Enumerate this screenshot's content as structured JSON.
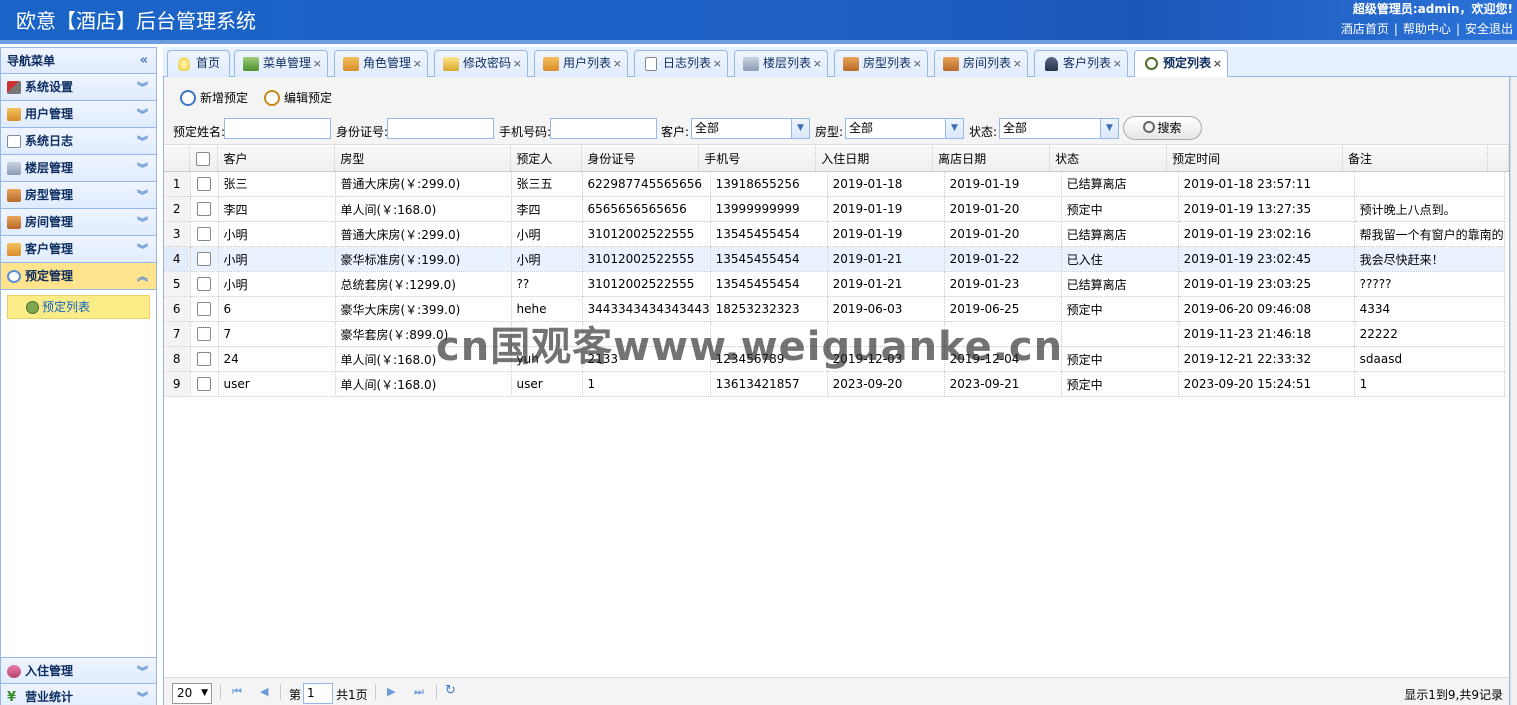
{
  "header": {
    "title": "欧意【酒店】后台管理系统",
    "welcome": "超级管理员:admin，欢迎您!",
    "links": [
      "酒店首页",
      "帮助中心",
      "安全退出"
    ]
  },
  "sidebar": {
    "title": "导航菜单",
    "items": [
      {
        "label": "系统设置",
        "icon": "tools-icon"
      },
      {
        "label": "用户管理",
        "icon": "users-icon"
      },
      {
        "label": "系统日志",
        "icon": "log-icon"
      },
      {
        "label": "楼层管理",
        "icon": "building-icon"
      },
      {
        "label": "房型管理",
        "icon": "house-icon"
      },
      {
        "label": "房间管理",
        "icon": "house-icon"
      },
      {
        "label": "客户管理",
        "icon": "users-icon"
      },
      {
        "label": "预定管理",
        "icon": "clock-icon"
      }
    ],
    "active_sub": "预定列表",
    "bottom_items": [
      {
        "label": "入住管理",
        "icon": "checkin-icon"
      },
      {
        "label": "营业统计",
        "icon": "money-icon"
      }
    ]
  },
  "tabs": [
    "首页",
    "菜单管理",
    "角色管理",
    "修改密码",
    "用户列表",
    "日志列表",
    "楼层列表",
    "房型列表",
    "房间列表",
    "客户列表",
    "预定列表"
  ],
  "toolbar": {
    "add_label": "新增预定",
    "edit_label": "编辑预定"
  },
  "search": {
    "name_label": "预定姓名:",
    "id_label": "身份证号:",
    "phone_label": "手机号码:",
    "customer_label": "客户:",
    "customer_value": "全部",
    "room_type_label": "房型:",
    "room_type_value": "全部",
    "status_label": "状态:",
    "status_value": "全部",
    "search_button": "搜索"
  },
  "grid": {
    "columns": [
      "客户",
      "房型",
      "预定人",
      "身份证号",
      "手机号",
      "入住日期",
      "离店日期",
      "状态",
      "预定时间",
      "备注"
    ],
    "rows": [
      {
        "num": "1",
        "cells": [
          "张三",
          "普通大床房(￥:299.0)",
          "张三五",
          "622987745565656",
          "13918655256",
          "2019-01-18",
          "2019-01-19",
          "已结算离店",
          "2019-01-18 23:57:11",
          ""
        ]
      },
      {
        "num": "2",
        "cells": [
          "李四",
          "单人间(￥:168.0)",
          "李四",
          "6565656565656",
          "13999999999",
          "2019-01-19",
          "2019-01-20",
          "预定中",
          "2019-01-19 13:27:35",
          "预计晚上八点到。"
        ]
      },
      {
        "num": "3",
        "cells": [
          "小明",
          "普通大床房(￥:299.0)",
          "小明",
          "31012002522555",
          "13545455454",
          "2019-01-19",
          "2019-01-20",
          "已结算离店",
          "2019-01-19 23:02:16",
          "帮我留一个有窗户的靠南的"
        ]
      },
      {
        "num": "4",
        "cells": [
          "小明",
          "豪华标准房(￥:199.0)",
          "小明",
          "31012002522555",
          "13545455454",
          "2019-01-21",
          "2019-01-22",
          "已入住",
          "2019-01-19 23:02:45",
          "我会尽快赶来！"
        ]
      },
      {
        "num": "5",
        "cells": [
          "小明",
          "总统套房(￥:1299.0)",
          "??",
          "31012002522555",
          "13545455454",
          "2019-01-21",
          "2019-01-23",
          "已结算离店",
          "2019-01-19 23:03:25",
          "?????"
        ]
      },
      {
        "num": "6",
        "cells": [
          "6",
          "豪华大床房(￥:399.0)",
          "hehe",
          "3443343434343443",
          "18253232323",
          "2019-06-03",
          "2019-06-25",
          "预定中",
          "2019-06-20 09:46:08",
          "4334"
        ]
      },
      {
        "num": "7",
        "cells": [
          "7",
          "豪华套房(￥:899.0)",
          "",
          "",
          "",
          "",
          "",
          "",
          "2019-11-23 21:46:18",
          "22222"
        ]
      },
      {
        "num": "8",
        "cells": [
          "24",
          "单人间(￥:168.0)",
          "yuh",
          "2133",
          "123456789",
          "2019-12-03",
          "2019-12-04",
          "预定中",
          "2019-12-21 22:33:32",
          "sdaasd"
        ]
      },
      {
        "num": "9",
        "cells": [
          "user",
          "单人间(￥:168.0)",
          "user",
          "1",
          "13613421857",
          "2023-09-20",
          "2023-09-21",
          "预定中",
          "2023-09-20 15:24:51",
          "1"
        ]
      }
    ]
  },
  "pager": {
    "page_size": "20",
    "page_prefix": "第",
    "page_value": "1",
    "page_suffix": "共1页",
    "info": "显示1到9,共9记录"
  },
  "watermark": "cn国观客www.weiguanke.cn"
}
